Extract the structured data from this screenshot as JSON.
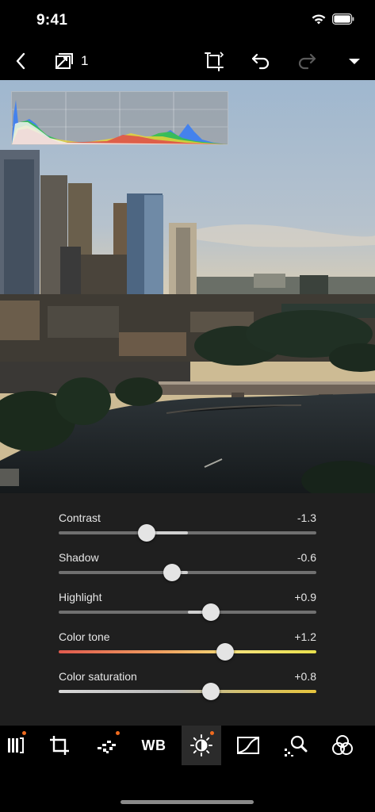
{
  "status_bar": {
    "time": "9:41"
  },
  "toolbar": {
    "copy_count": "1",
    "icons": [
      "back-icon",
      "copy-adjust-icon",
      "crop-rotate-icon",
      "undo-icon",
      "redo-icon",
      "menu-chevron-icon"
    ],
    "redo_enabled": false
  },
  "adjustments": [
    {
      "label": "Contrast",
      "value": "-1.3",
      "level": 0.34
    },
    {
      "label": "Shadow",
      "value": "-0.6",
      "level": 0.44
    },
    {
      "label": "Highlight",
      "value": "+0.9",
      "level": 0.59
    },
    {
      "label": "Color tone",
      "value": "+1.2",
      "level": 0.645
    },
    {
      "label": "Color saturation",
      "value": "+0.8",
      "level": 0.59
    }
  ],
  "tools": {
    "items": [
      "adjust-filter-icon",
      "crop-icon",
      "effects-icon",
      "white-balance-icon",
      "light-icon",
      "tone-curve-icon",
      "detail-icon",
      "color-icon"
    ],
    "wb_label": "WB",
    "active": "light"
  },
  "colors": {
    "accent_dot": "#ef6a1e",
    "panel_bg": "#1f1f1f"
  }
}
